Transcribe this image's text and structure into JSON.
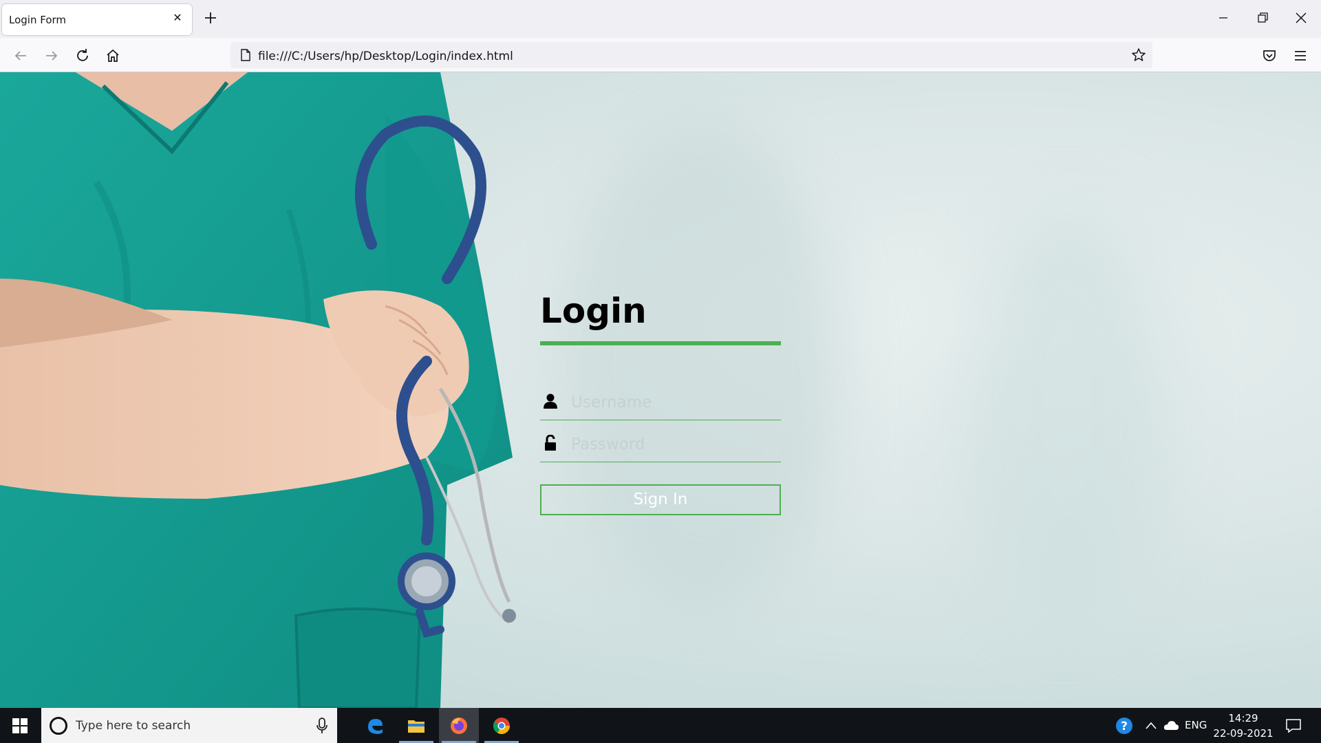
{
  "browser": {
    "tab_title": "Login Form",
    "url": "file:///C:/Users/hp/Desktop/Login/index.html"
  },
  "login": {
    "title": "Login",
    "username_placeholder": "Username",
    "password_placeholder": "Password",
    "signin_label": "Sign In",
    "accent_color": "#4caf50"
  },
  "taskbar": {
    "search_placeholder": "Type here to search",
    "language": "ENG",
    "time": "14:29",
    "date": "22-09-2021",
    "apps": [
      "edge",
      "file-explorer",
      "firefox",
      "chrome"
    ]
  }
}
